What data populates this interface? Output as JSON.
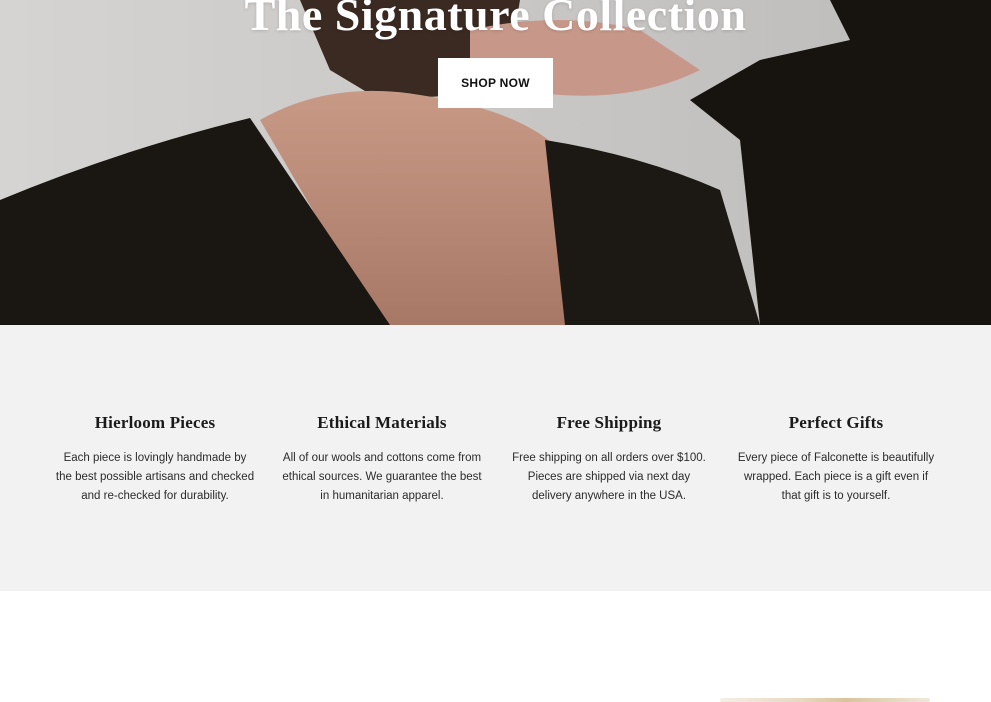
{
  "hero": {
    "title": "The Signature Collection",
    "cta_label": "SHOP NOW"
  },
  "features": [
    {
      "title": "Hierloom Pieces",
      "lines": [
        "Each piece is lovingly handmade by",
        "the best possible artisans and checked",
        "and re-checked for durability."
      ]
    },
    {
      "title": "Ethical Materials",
      "lines": [
        "All of our wools and cottons come from",
        "ethical sources. We guarantee the best",
        "in humanitarian apparel."
      ]
    },
    {
      "title": "Free Shipping",
      "lines": [
        "Free shipping on all orders over $100.",
        "Pieces are shipped via next day",
        "delivery anywhere in the USA."
      ]
    },
    {
      "title": "Perfect Gifts",
      "lines": [
        "Every piece of Falconette is beautifully",
        "wrapped. Each piece is a gift even if",
        "that gift is to yourself."
      ]
    }
  ],
  "colors": {
    "features_bg": "#f2f2f2",
    "button_bg": "#ffffff",
    "hero_text": "#ffffff"
  }
}
